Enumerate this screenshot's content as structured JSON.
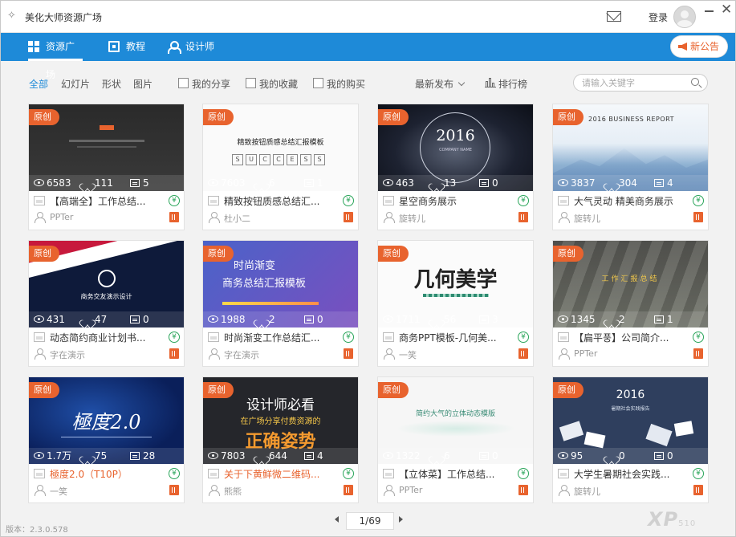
{
  "app": {
    "title": "美化大师资源广场"
  },
  "titlebar": {
    "login_label": "登录"
  },
  "nav": {
    "items": [
      {
        "label": "资源广场"
      },
      {
        "label": "教程"
      },
      {
        "label": "设计师"
      }
    ],
    "notice_label": "新公告"
  },
  "filters": {
    "types": [
      "全部",
      "幻灯片",
      "形状",
      "图片"
    ],
    "checks": [
      "我的分享",
      "我的收藏",
      "我的购买"
    ],
    "sort_label": "最新发布",
    "rank_label": "排行榜",
    "search_placeholder": "请输入关键字"
  },
  "badge_label": "原创",
  "cards": [
    {
      "views": "6583",
      "likes": "111",
      "comments": "5",
      "title": "【高端全】工作总结...",
      "author": "PPTer"
    },
    {
      "views": "7603",
      "likes": "6",
      "comments": "1",
      "title": "精致按钮质感总结汇...",
      "author": "杜小二",
      "thumb_title": "精致按钮质感总结汇报模板",
      "thumb_letters": [
        "S",
        "U",
        "C",
        "C",
        "E",
        "S",
        "S"
      ]
    },
    {
      "views": "463",
      "likes": "13",
      "comments": "0",
      "title": "星空商务展示",
      "author": "旋转儿",
      "thumb_title": "2016",
      "thumb_sub": "COMPANY NAME"
    },
    {
      "views": "3837",
      "likes": "304",
      "comments": "4",
      "title": "大气灵动 精美商务展示",
      "author": "旋转儿",
      "thumb_title": "2016 BUSINESS REPORT"
    },
    {
      "views": "431",
      "likes": "47",
      "comments": "0",
      "title": "动态简约商业计划书...",
      "author": "字在演示",
      "thumb_title": "商务交友演示设计"
    },
    {
      "views": "1988",
      "likes": "2",
      "comments": "0",
      "title": "时尚渐变工作总结汇...",
      "author": "字在演示",
      "thumb_title": "时尚渐变",
      "thumb_sub": "商务总结汇报模板"
    },
    {
      "views": "1711",
      "likes": "56",
      "comments": "3",
      "title": "商务PPT模板-几何美...",
      "author": "一笑",
      "thumb_title": "几何美学"
    },
    {
      "views": "1345",
      "likes": "2",
      "comments": "1",
      "title": "【扁平풍】公司简介...",
      "author": "PPTer",
      "thumb_title": "工作汇报总结"
    },
    {
      "views": "1.7万",
      "likes": "75",
      "comments": "28",
      "title": "極度2.0（T10P）",
      "author": "一笑",
      "thumb_title": "極度2.0",
      "hot": true
    },
    {
      "views": "7803",
      "likes": "644",
      "comments": "4",
      "title": "关于下黄鲜微二维码...",
      "author": "熊熊",
      "thumb_title": "设计师必看",
      "thumb_sub": "在广场分享付费资源的",
      "thumb_big": "正确姿势",
      "hot": true
    },
    {
      "views": "1322",
      "likes": "6",
      "comments": "0",
      "title": "【立体菜】工作总结...",
      "author": "PPTer",
      "thumb_title": "简约大气的立体动态模版"
    },
    {
      "views": "95",
      "likes": "0",
      "comments": "0",
      "title": "大学生暑期社会实践...",
      "author": "旋转儿",
      "thumb_title": "2016",
      "thumb_sub": "暑期社会实践报告"
    }
  ],
  "pager": {
    "current": "1/69"
  },
  "footer": {
    "version": "版本：2.3.0.578"
  },
  "watermark": {
    "main": "XP",
    "sub": "510"
  },
  "colors": {
    "accent": "#1e8ad8",
    "badge": "#e8632e",
    "coin": "#2aa55a"
  }
}
